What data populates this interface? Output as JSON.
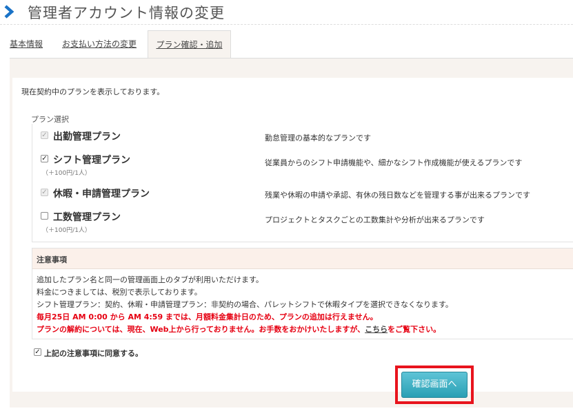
{
  "page": {
    "title": "管理者アカウント情報の変更",
    "header_icon": "chevron-right-icon",
    "accent_color": "#1a73c7"
  },
  "tabs": [
    {
      "label": "基本情報",
      "active": false
    },
    {
      "label": "お支払い方法の変更",
      "active": false
    },
    {
      "label": "プラン確認・追加",
      "active": true
    }
  ],
  "main": {
    "intro": "現在契約中のプランを表示しております。",
    "plan_select_label": "プラン選択",
    "plans": [
      {
        "name": "出勤管理プラン",
        "price": "",
        "description": "勤怠管理の基本的なプランです",
        "checked": true,
        "disabled": true
      },
      {
        "name": "シフト管理プラン",
        "price": "（＋100円/1人）",
        "description": "従業員からのシフト申請機能や、細かなシフト作成機能が使えるプランです",
        "checked": true,
        "disabled": false
      },
      {
        "name": "休暇・申請管理プラン",
        "price": "",
        "description": "残業や休暇の申請や承認、有休の残日数などを管理する事が出来るプランです",
        "checked": true,
        "disabled": true
      },
      {
        "name": "工数管理プラン",
        "price": "（＋100円/1人）",
        "description": "プロジェクトとタスクごとの工数集計や分析が出来るプランです",
        "checked": false,
        "disabled": false
      }
    ],
    "notice": {
      "heading": "注意事項",
      "lines": [
        "追加したプラン名と同一の管理画面上のタブが利用いただけます。",
        "料金につきましては、税別で表示しております。",
        "シフト管理プラン：契約、休暇・申請管理プラン：非契約の場合、パレットシフトで休暇タイプを選択できなくなります。"
      ],
      "warning_1": "毎月25日 AM 0:00 から AM 4:59 までは、月額料金集計日のため、プランの追加は行えません。",
      "warning_2_before": "プランの解約については、現在、Web上から行っておりません。お手数をおかけいたしますが、",
      "warning_2_link": "こちら",
      "warning_2_after": "をご覧下さい。",
      "warning_color": "#e60012"
    },
    "agree_label": "上記の注意事項に同意する。",
    "agree_checked": true,
    "confirm_button": "確認画面へ",
    "button_color": "#34a8bc",
    "highlight_color": "#e8141d"
  }
}
